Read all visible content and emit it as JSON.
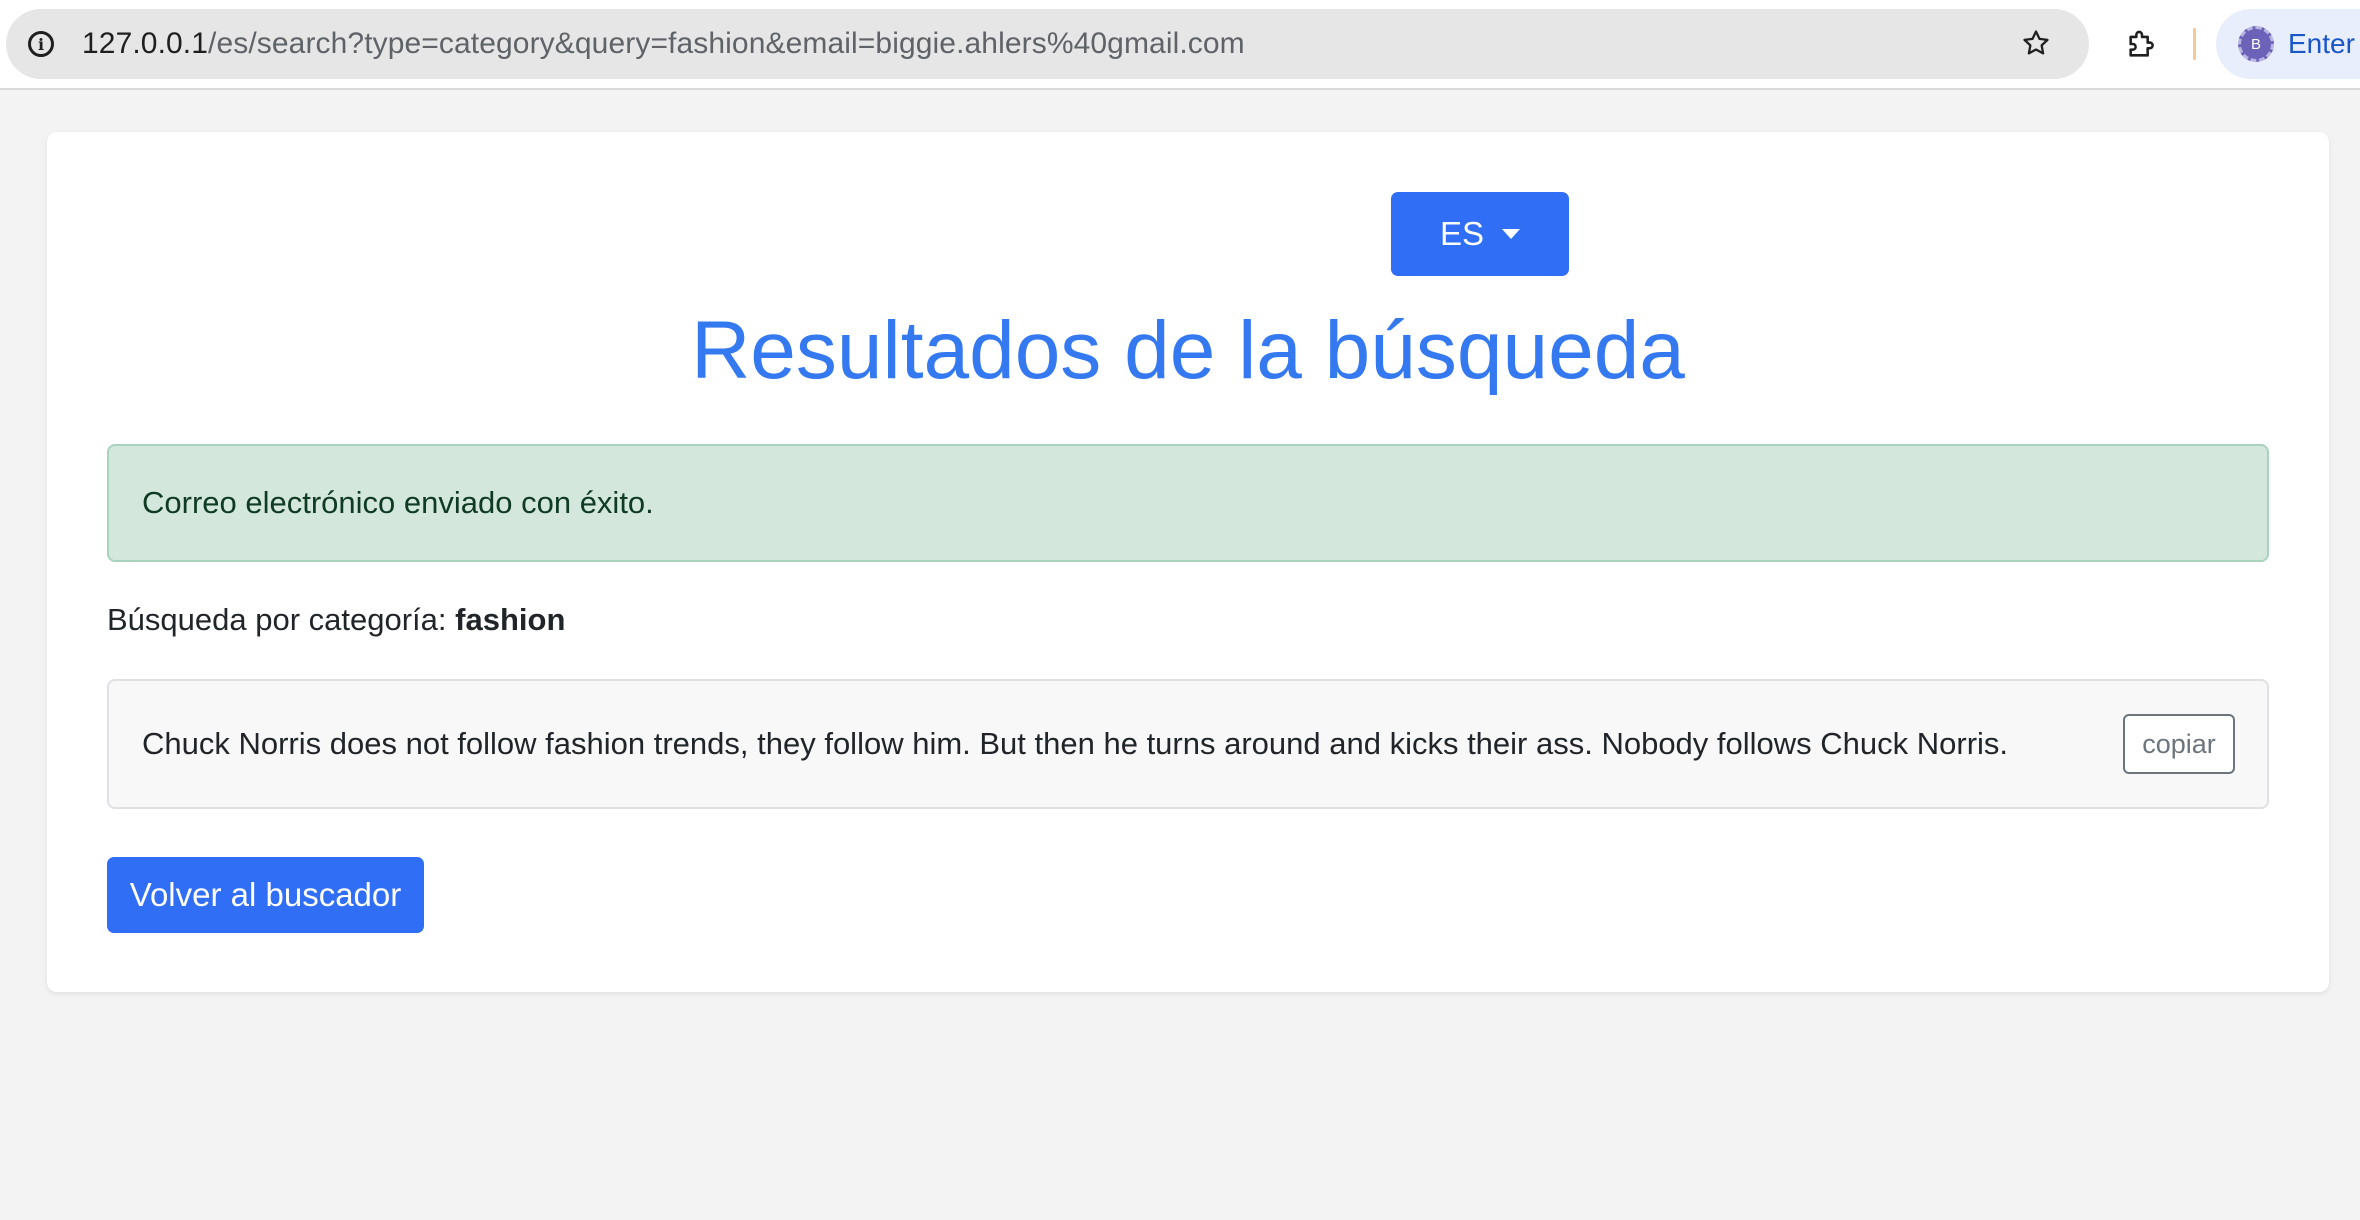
{
  "browser": {
    "url_host": "127.0.0.1",
    "url_path": "/es/search?type=category&query=fashion&email=biggie.ahlers%40gmail.com",
    "profile_initial": "B",
    "profile_label": "Enter"
  },
  "page": {
    "language_button": "ES",
    "title": "Resultados de la búsqueda",
    "alert_message": "Correo electrónico enviado con éxito.",
    "search_prefix": "Búsqueda por categoría:",
    "search_term": "fashion",
    "results": [
      {
        "text": "Chuck Norris does not follow fashion trends, they follow him. But then he turns around and kicks their ass. Nobody follows Chuck Norris.",
        "copy_label": "copiar"
      }
    ],
    "back_button": "Volver al buscador"
  },
  "colors": {
    "primary": "#2f6ef5",
    "title": "#3579f0",
    "alert_bg": "#d4e7dd"
  }
}
